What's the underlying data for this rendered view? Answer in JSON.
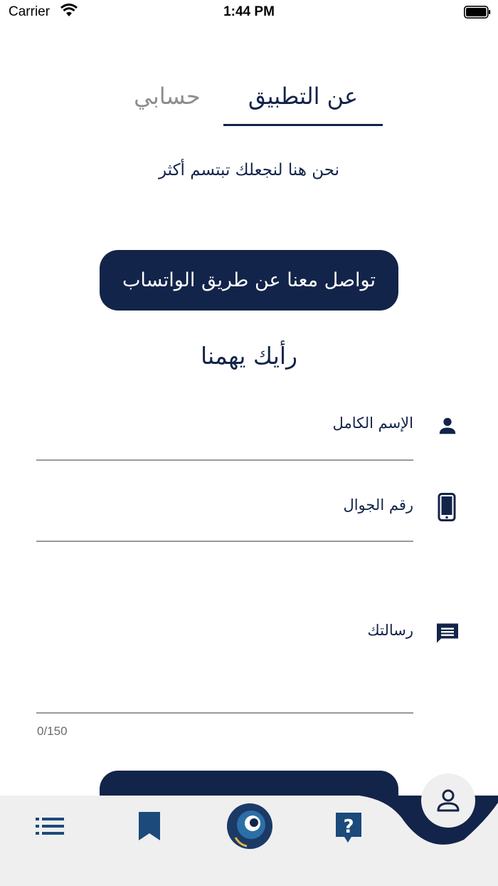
{
  "status_bar": {
    "carrier": "Carrier",
    "time": "1:44 PM"
  },
  "tabs": [
    {
      "label": "عن التطبيق",
      "active": true
    },
    {
      "label": "حسابي",
      "active": false
    }
  ],
  "tagline": "نحن هنا لنجعلك تبتسم أكثر",
  "whatsapp_button": "تواصل معنا عن طريق الواتساب",
  "feedback": {
    "heading": "رأيك يهمنا",
    "fields": {
      "full_name_label": "الإسم الكامل",
      "mobile_label": "رقم الجوال",
      "message_label": "رسالتك",
      "message_counter": "0/150"
    }
  },
  "bottom_nav": {
    "items": [
      "list-icon",
      "bookmark-icon",
      "app-logo",
      "help-icon",
      "account-icon"
    ]
  },
  "colors": {
    "primary": "#13244a",
    "inactive_tab": "#8d8d8d",
    "tabbar_bg": "#efefef",
    "help_icon": "#1c4a7a"
  }
}
